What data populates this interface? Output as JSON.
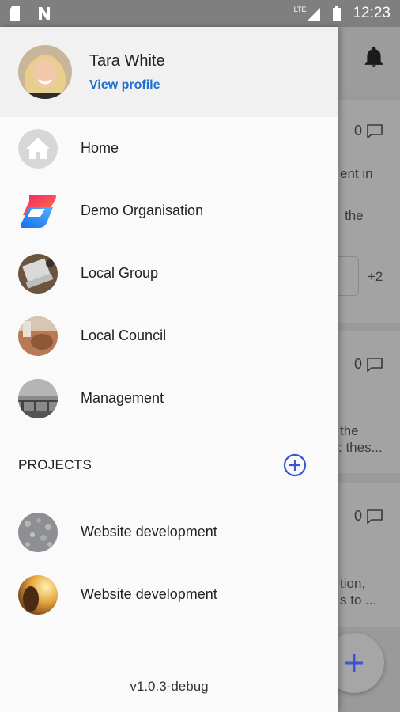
{
  "statusbar": {
    "time": "12:23",
    "network": "LTE"
  },
  "profile": {
    "name": "Tara White",
    "link": "View profile"
  },
  "menu": [
    {
      "label": "Home",
      "icon": "home-icon"
    },
    {
      "label": "Demo Organisation",
      "icon": "organisation-logo"
    },
    {
      "label": "Local Group",
      "icon": "group-avatar"
    },
    {
      "label": "Local Council",
      "icon": "council-avatar"
    },
    {
      "label": "Management",
      "icon": "management-avatar"
    }
  ],
  "projects": {
    "title": "PROJECTS",
    "items": [
      {
        "label": "Website development",
        "icon": "project-avatar"
      },
      {
        "label": "Website development",
        "icon": "project-avatar"
      }
    ]
  },
  "version": "v1.0.3-debug",
  "background": {
    "card1": {
      "count": "0",
      "text1": "ent in",
      "text2": "the",
      "extra": "+2"
    },
    "card2": {
      "count": "0",
      "text1": "the",
      "text2": ": thes..."
    },
    "card3": {
      "count": "0",
      "text1": "tion,",
      "text2": "s to ..."
    }
  },
  "colors": {
    "accent": "#1e6fd0",
    "add_icon": "#3a55d6"
  }
}
